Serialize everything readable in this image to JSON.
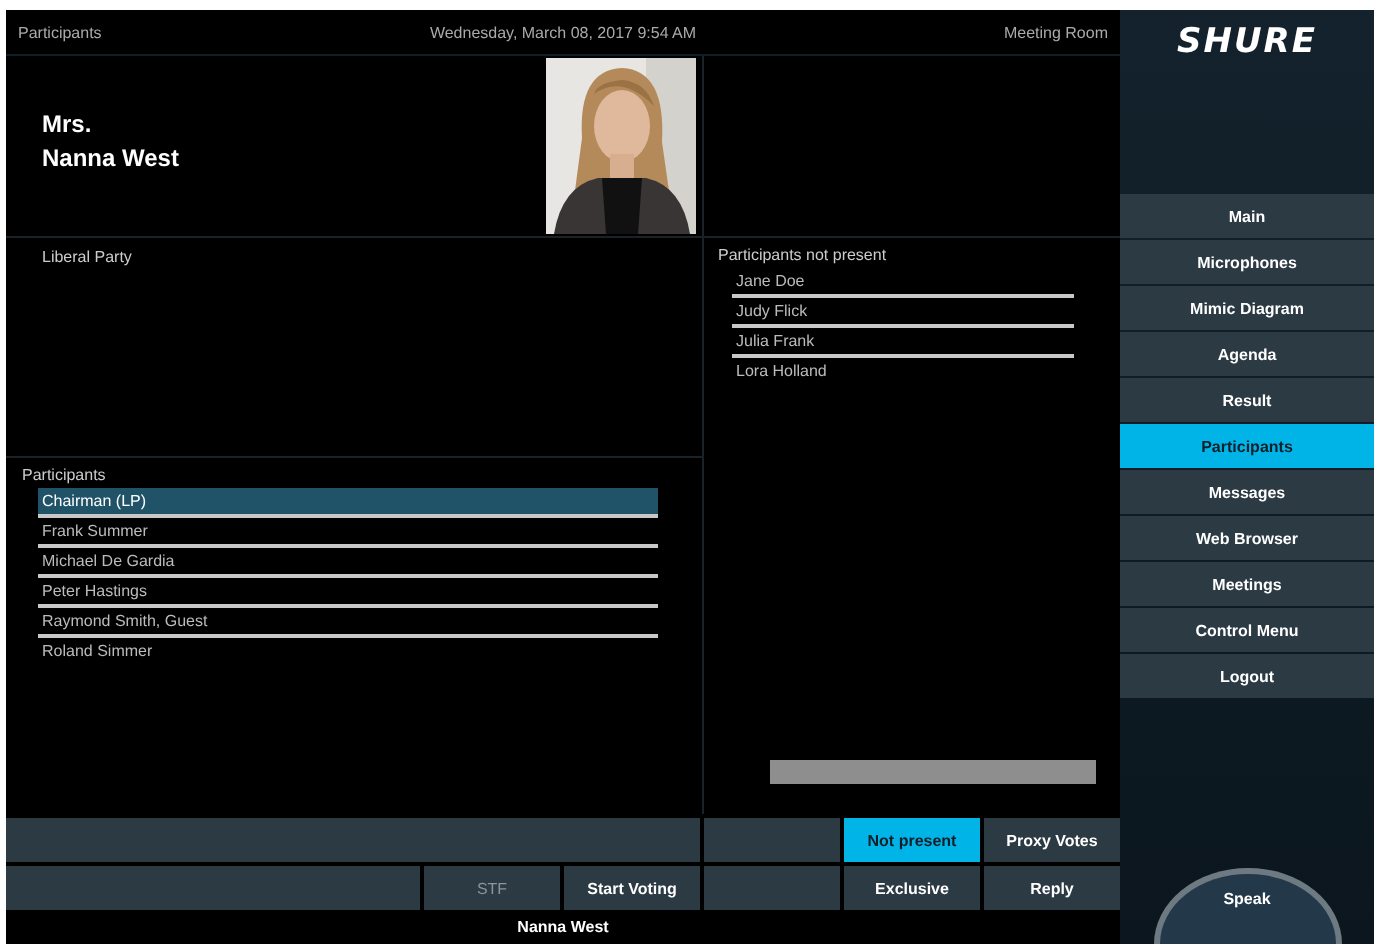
{
  "header": {
    "title": "Participants",
    "datetime": "Wednesday, March 08, 2017 9:54 AM",
    "room": "Meeting Room"
  },
  "speaker": {
    "salutation": "Mrs.",
    "name": "Nanna West",
    "party": "Liberal Party"
  },
  "participants": {
    "title": "Participants",
    "items": [
      {
        "name": "Chairman  (LP)",
        "selected": true
      },
      {
        "name": "Frank Summer",
        "selected": false
      },
      {
        "name": "Michael De Gardia",
        "selected": false
      },
      {
        "name": "Peter Hastings",
        "selected": false
      },
      {
        "name": "Raymond Smith, Guest",
        "selected": false
      },
      {
        "name": "Roland  Simmer",
        "selected": false
      }
    ]
  },
  "not_present": {
    "title": "Participants not present",
    "items": [
      {
        "name": "Jane Doe",
        "selected": false
      },
      {
        "name": "Judy Flick",
        "selected": false
      },
      {
        "name": "Julia  Frank",
        "selected": false
      },
      {
        "name": "Lora Holland",
        "selected": false
      }
    ]
  },
  "left_buttons": [
    {
      "label": "STF",
      "selected": false,
      "disabled": true
    },
    {
      "label": "Start Voting",
      "selected": false,
      "disabled": false
    }
  ],
  "right_buttons": [
    {
      "label": "Not present",
      "selected": true,
      "disabled": false
    },
    {
      "label": "Proxy Votes",
      "selected": false,
      "disabled": false
    },
    {
      "label": "Exclusive",
      "selected": false,
      "disabled": false
    },
    {
      "label": "Reply",
      "selected": false,
      "disabled": false
    }
  ],
  "status": "Nanna West",
  "sidebar": {
    "logo": "SHURE",
    "items": [
      {
        "label": "Main",
        "selected": false
      },
      {
        "label": "Microphones",
        "selected": false
      },
      {
        "label": "Mimic Diagram",
        "selected": false
      },
      {
        "label": "Agenda",
        "selected": false
      },
      {
        "label": "Result",
        "selected": false
      },
      {
        "label": "Participants",
        "selected": true
      },
      {
        "label": "Messages",
        "selected": false
      },
      {
        "label": "Web Browser",
        "selected": false
      },
      {
        "label": "Meetings",
        "selected": false
      },
      {
        "label": "Control Menu",
        "selected": false
      },
      {
        "label": "Logout",
        "selected": false
      }
    ],
    "speak": "Speak"
  }
}
